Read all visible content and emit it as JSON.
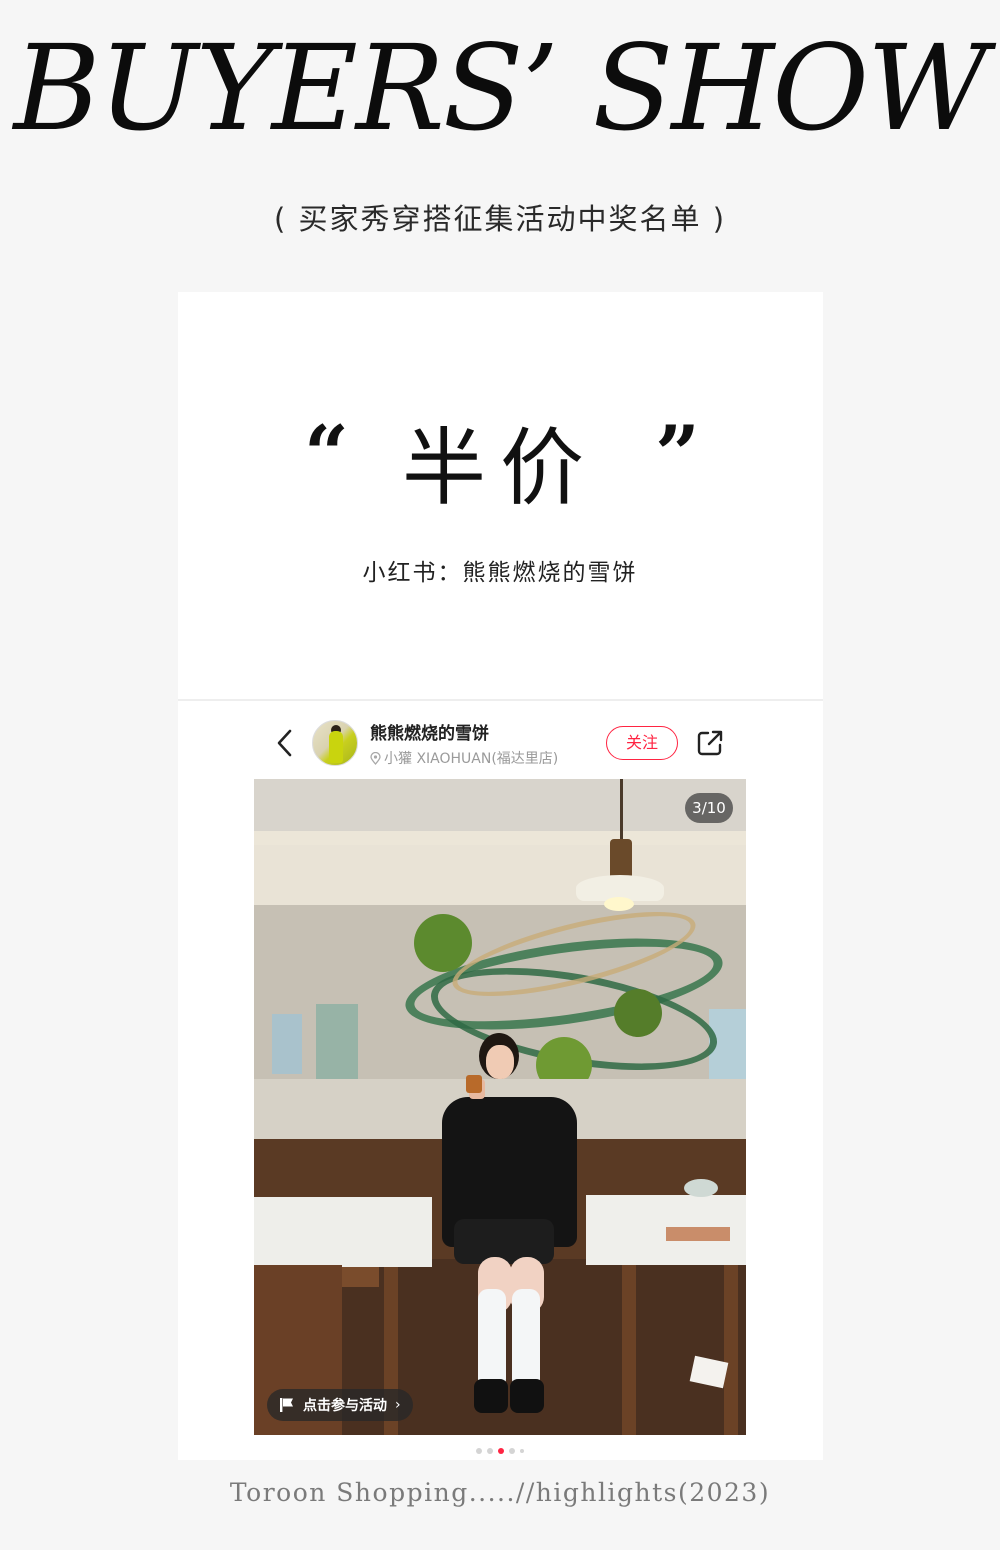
{
  "header": {
    "title": "BUYERS’ SHOW",
    "subtitle": "( 买家秀穿搭征集活动中奖名单 )"
  },
  "award": {
    "quote_open": "“",
    "title": "半价",
    "quote_close": "”",
    "credit": "小红书：熊熊燃烧的雪饼"
  },
  "post": {
    "back_icon": "chevron-left-icon",
    "user_name": "熊熊燃烧的雪饼",
    "location": "小獾 XIAOHUAN(福达里店)",
    "follow_label": "关注",
    "share_icon": "share-icon",
    "counter": "3/10",
    "activity_label": "点击参与活动",
    "pager": {
      "total": 5,
      "active_index": 2
    }
  },
  "colors": {
    "accent": "#ff2442",
    "background": "#f6f6f6",
    "card": "#ffffff"
  },
  "footer": {
    "text": "Toroon Shopping.....//highlights(2023)"
  }
}
